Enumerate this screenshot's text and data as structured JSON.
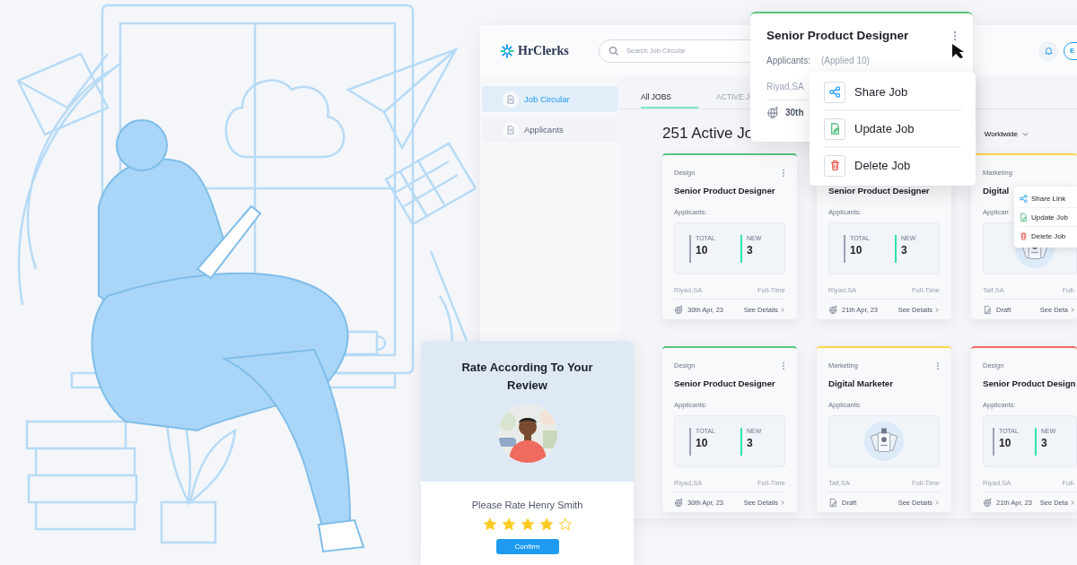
{
  "brand": {
    "name": "HrClerks"
  },
  "search": {
    "placeholder": "Search Job Circular"
  },
  "language_button": {
    "label": "E"
  },
  "sidebar": {
    "items": [
      {
        "label": "Job Circular",
        "selected": true
      },
      {
        "label": "Applicants",
        "selected": false
      }
    ]
  },
  "tabs": [
    {
      "label": "All JOBS",
      "selected": true
    },
    {
      "label": "ACTIVE J",
      "selected": false
    }
  ],
  "heading": "251 Active Jo",
  "location_filter": "Worldwide",
  "jobs": [
    {
      "kind": "stats",
      "color": "#5cc27b",
      "menu": true,
      "category": "Design",
      "title": "Senior Product Designer",
      "applicants_label": "Applicants:",
      "total_label": "TOTAL",
      "total": "10",
      "new_label": "NEW",
      "new": "3",
      "location": "Riyad,SA",
      "job_type": "Full-Time",
      "footer": {
        "kind": "date",
        "text": "30th Apr, 23"
      },
      "details_link": "See Details"
    },
    {
      "kind": "stats",
      "menu": false,
      "title": "Senior Product Designer",
      "applicants_label": "Applicants:",
      "total_label": "TOTAL",
      "total": "10",
      "new_label": "NEW",
      "new": "3",
      "location": "Riyad,SA",
      "job_type": "Full-Time",
      "footer": {
        "kind": "date",
        "text": "21th Apr, 23"
      },
      "details_link": "See Details"
    },
    {
      "kind": "picture",
      "color": "#ffd54a",
      "menu": false,
      "category": "Marketing",
      "title": "Digital",
      "applicants_label": "Applican",
      "location": "Taif,SA",
      "job_type": "Full-",
      "footer": {
        "kind": "draft",
        "text": "Draft"
      },
      "details_link": "See Deta"
    },
    {
      "kind": "stats",
      "color": "#5cc27b",
      "menu": true,
      "category": "Design",
      "title": "Senior Product Designer",
      "applicants_label": "Applicants:",
      "total_label": "TOTAL",
      "total": "10",
      "new_label": "NEW",
      "new": "3",
      "location": "Riyad,SA",
      "job_type": "Full-Time",
      "footer": {
        "kind": "date",
        "text": "30th Apr, 23"
      },
      "details_link": "See Details"
    },
    {
      "kind": "picture",
      "color": "#ffd54a",
      "menu": true,
      "category": "Marketing",
      "title": "Digital Marketer",
      "applicants_label": "Applicants:",
      "location": "Taif,SA",
      "job_type": "Full-Time",
      "footer": {
        "kind": "draft",
        "text": "Draft"
      },
      "details_link": "See Details"
    },
    {
      "kind": "stats",
      "color": "#f06b5f",
      "menu": false,
      "category": "Design",
      "title": "Senior Product Design",
      "applicants_label": "Applicants:",
      "total_label": "TOTAL",
      "total": "10",
      "new_label": "NEW",
      "new": "3",
      "location": "Riyad,SA",
      "job_type": "Full-",
      "footer": {
        "kind": "date",
        "text": "21th Apr, 23"
      },
      "details_link": "See Deta"
    }
  ],
  "card_menu": {
    "items": [
      {
        "kind": "share",
        "label": "Share Link"
      },
      {
        "kind": "update",
        "label": "Update Job"
      },
      {
        "kind": "delete",
        "label": "Delete Job"
      }
    ]
  },
  "job_preview": {
    "color": "#5cc27b",
    "title": "Senior Product Designer",
    "applicants_label": "Applicants:",
    "applied": "(Applied 10)",
    "location": "Riyad,SA",
    "date": "30th"
  },
  "job_menu": {
    "items": [
      {
        "kind": "share",
        "label": "Share Job"
      },
      {
        "kind": "update",
        "label": "Update Job"
      },
      {
        "kind": "delete",
        "label": "Delete Job"
      }
    ]
  },
  "rating": {
    "title": "Rate According To Your Review",
    "prompt": "Please Rate Henry Smith",
    "stars": 4,
    "button": "Confirm"
  }
}
